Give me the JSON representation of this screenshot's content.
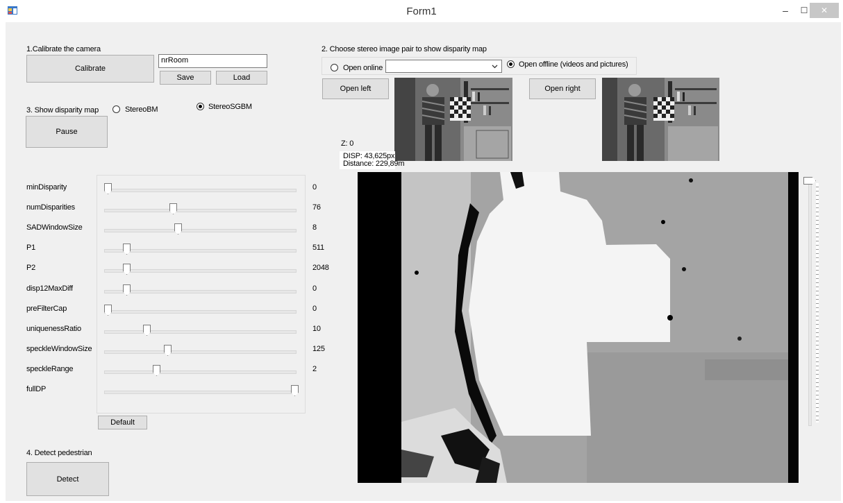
{
  "window": {
    "title": "Form1",
    "minimize": "–",
    "maximize": "☐",
    "close": "✕"
  },
  "calibrate": {
    "section_label": "1.Calibrate the camera",
    "button": "Calibrate",
    "name_value": "nrRoom",
    "save": "Save",
    "load": "Load"
  },
  "stereo": {
    "section_label": "2. Choose stereo image pair to show disparity map",
    "open_online": "Open online",
    "open_offline": "Open offline (videos and pictures)",
    "open_left": "Open left",
    "open_right": "Open right"
  },
  "disparity": {
    "section_label": "3. Show disparity map",
    "bm": "StereoBM",
    "sgbm": "StereoSGBM",
    "selected": "StereoSGBM",
    "pause": "Pause"
  },
  "readout": {
    "z": "Z: 0",
    "disp": "DISP: 43,625px",
    "distance": "Distance: 229,89m"
  },
  "params": [
    {
      "name": "minDisparity",
      "value": "0",
      "pos": 0.0
    },
    {
      "name": "numDisparities",
      "value": "76",
      "pos": 0.35
    },
    {
      "name": "SADWindowSize",
      "value": "8",
      "pos": 0.375
    },
    {
      "name": "P1",
      "value": "511",
      "pos": 0.1
    },
    {
      "name": "P2",
      "value": "2048",
      "pos": 0.1
    },
    {
      "name": "disp12MaxDiff",
      "value": "0",
      "pos": 0.1
    },
    {
      "name": "preFilterCap",
      "value": "0",
      "pos": 0.0
    },
    {
      "name": "uniquenessRatio",
      "value": "10",
      "pos": 0.21
    },
    {
      "name": "speckleWindowSize",
      "value": "125",
      "pos": 0.32
    },
    {
      "name": "speckleRange",
      "value": "2",
      "pos": 0.26
    },
    {
      "name": "fullDP",
      "value": "",
      "pos": 1.0
    }
  ],
  "default_button": "Default",
  "detect": {
    "section_label": "4. Detect pedestrian",
    "button": "Detect"
  },
  "vertical_slider": {
    "pos": 0.0
  }
}
